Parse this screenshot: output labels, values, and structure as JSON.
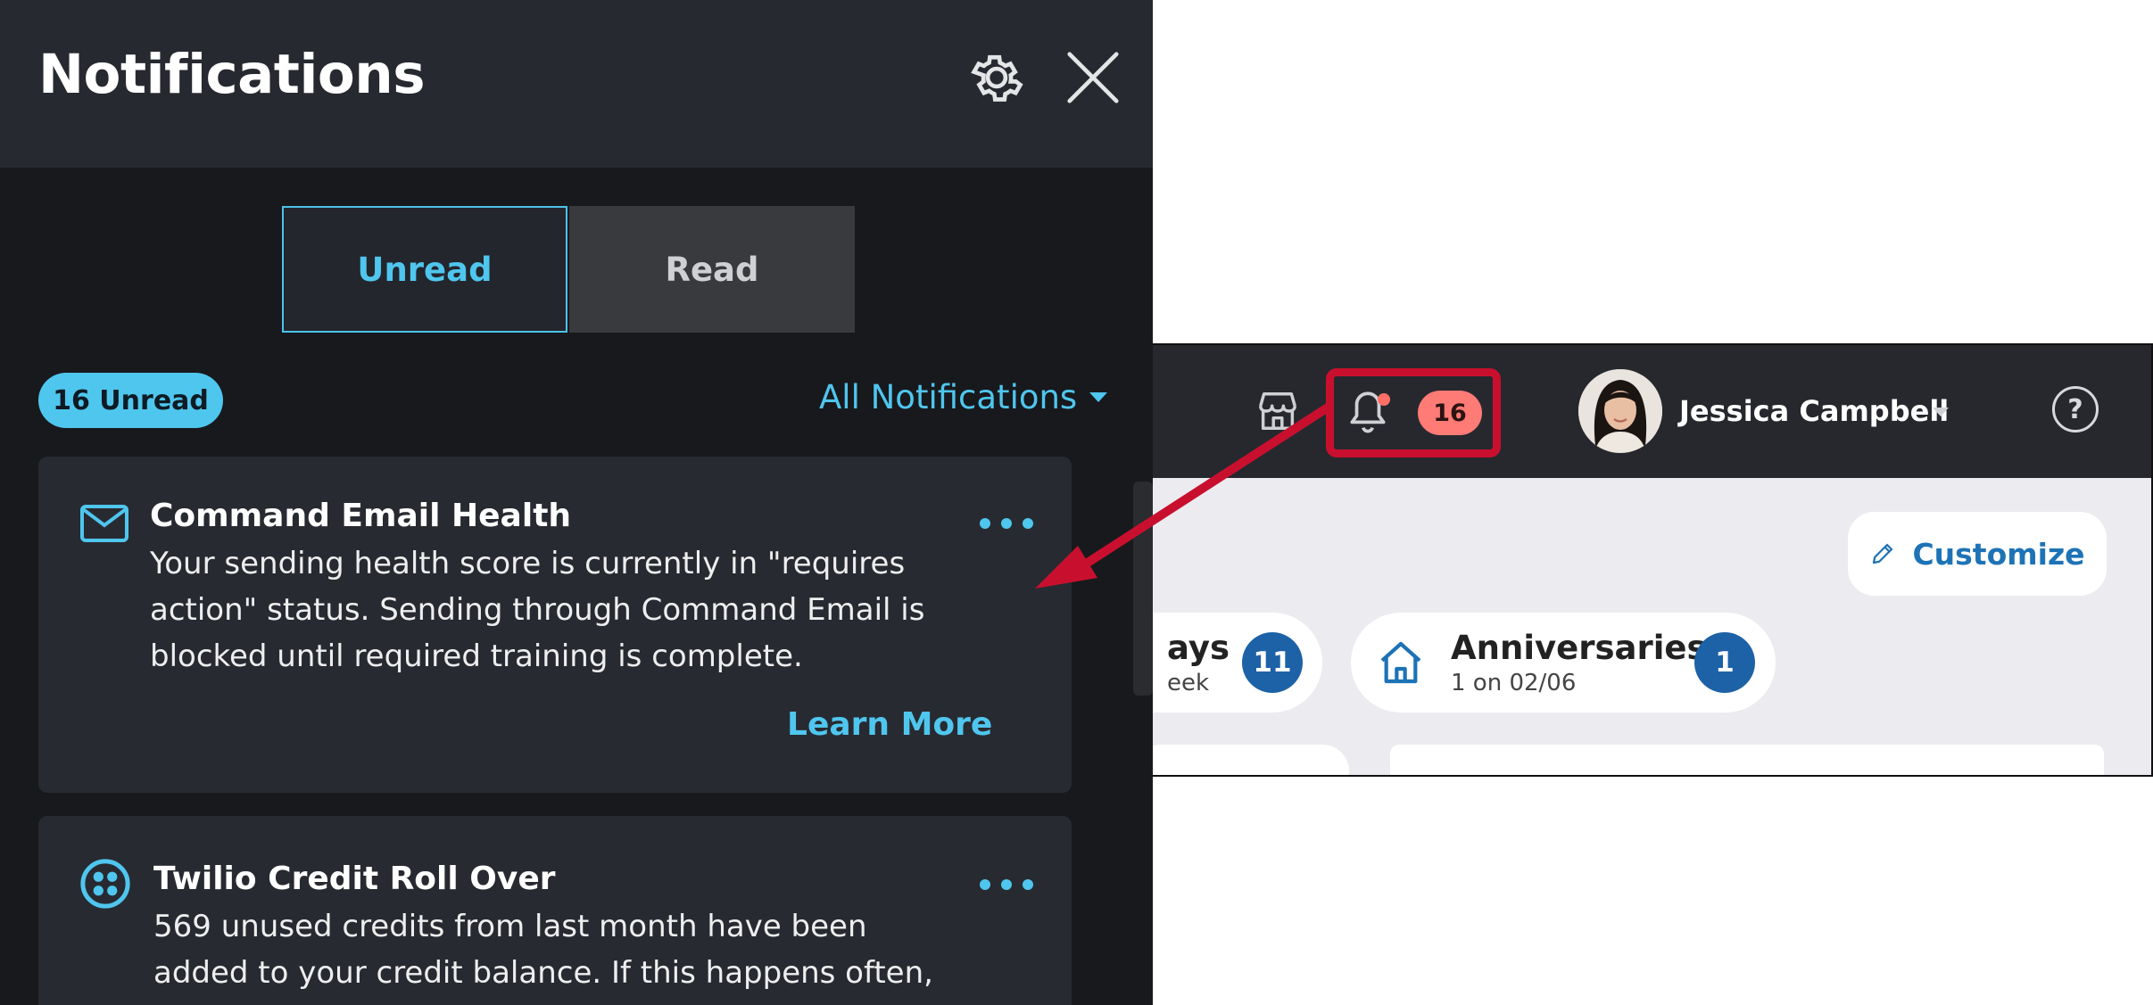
{
  "panel": {
    "title": "Notifications",
    "tabs": [
      {
        "label": "Unread",
        "active": true
      },
      {
        "label": "Read",
        "active": false
      }
    ],
    "unread_badge": "16 Unread",
    "filter_label": "All Notifications",
    "icons": {
      "settings": "gear-icon",
      "close": "close-icon"
    }
  },
  "notifications": [
    {
      "icon": "envelope-icon",
      "title": "Command Email Health",
      "body": "Your sending health score is currently in \"requires action\" status. Sending through Command Email is blocked until required training is complete.",
      "link": "Learn More"
    },
    {
      "icon": "twilio-icon",
      "title": "Twilio Credit Roll Over",
      "body": "569 unused credits from last month have been added to your credit balance. If this happens often,"
    }
  ],
  "app": {
    "notification_count": "16",
    "user_name": "Jessica Campbell",
    "help_label": "?",
    "customize_label": "Customize",
    "chips": [
      {
        "title": "ays",
        "subtitle": "eek",
        "count": "11"
      },
      {
        "title": "Anniversaries",
        "subtitle": "1 on 02/06",
        "count": "1"
      }
    ]
  },
  "colors": {
    "accent": "#4fc6ee",
    "panel_bg": "#18191d",
    "highlight": "#c8102e",
    "badge_red": "#ff7b75"
  }
}
